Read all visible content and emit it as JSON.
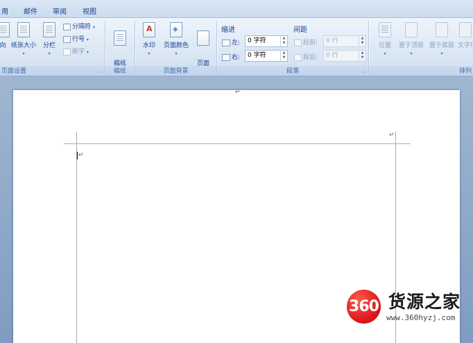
{
  "tabs": [
    "用",
    "邮件",
    "审阅",
    "视图"
  ],
  "ribbon": {
    "page_setup": {
      "buttons": [
        "向",
        "纸张大小",
        "分栏"
      ],
      "small_items": [
        "分隔符",
        "行号",
        "断字"
      ],
      "label": "页面设置"
    },
    "draft": {
      "button": "稿纸\n设置",
      "label": "稿纸"
    },
    "background": {
      "watermark": "水印",
      "page_color": "页面颜色",
      "page_border": "页面\n边框",
      "label": "页面背景"
    },
    "paragraph": {
      "indent_header": "缩进",
      "indent_left_label": "左:",
      "indent_left_value": "0 字符",
      "indent_right_label": "右:",
      "indent_right_value": "0 字符",
      "spacing_header": "间距",
      "spacing_before_label": "段前:",
      "spacing_before_value": "0 行",
      "spacing_after_label": "段后:",
      "spacing_after_value": "0 行",
      "label": "段落"
    },
    "arrange": {
      "buttons": [
        "位置",
        "置于顶层",
        "置于底层",
        "文字环"
      ],
      "label": "排列"
    }
  },
  "document": {
    "paragraph_mark": "↵"
  },
  "watermark": {
    "logo_text": "360",
    "title": "货源之家",
    "url": "www.360hyzj.com"
  },
  "colors": {
    "accent": "#15428b",
    "logo_red": "#d9131a"
  }
}
